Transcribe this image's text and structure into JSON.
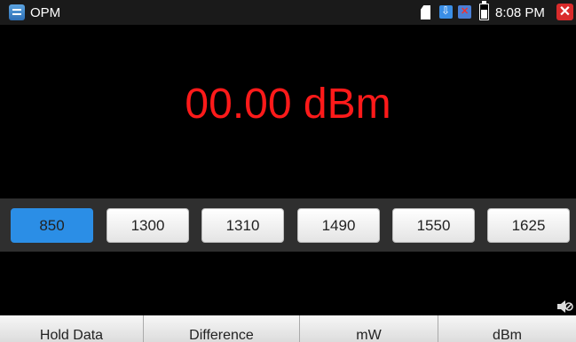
{
  "status_bar": {
    "app_title": "OPM",
    "time": "8:08 PM"
  },
  "reading": {
    "value": "00.00 dBm",
    "color": "#ff1a1a"
  },
  "wavelengths": {
    "items": [
      "850",
      "1300",
      "1310",
      "1490",
      "1550",
      "1625"
    ],
    "selected": "850",
    "accent": "#2b8ee6"
  },
  "bottom_tabs": [
    "Hold Data",
    "Difference",
    "mW",
    "dBm"
  ]
}
